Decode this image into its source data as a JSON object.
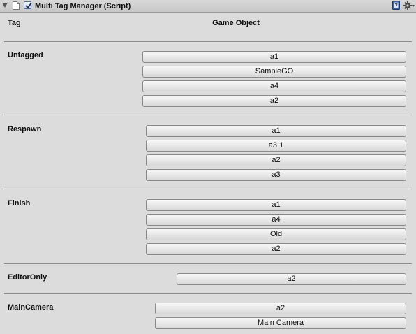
{
  "header": {
    "title": "Multi Tag Manager (Script)",
    "enabled": true,
    "icons": [
      "foldout-arrow-icon",
      "script-icon",
      "help-icon",
      "gear-icon"
    ]
  },
  "columns": {
    "tag": "Tag",
    "game_object": "Game Object"
  },
  "groups": [
    {
      "tag": "Untagged",
      "objects": [
        "a1",
        "SampleGO",
        "a4",
        "a2"
      ]
    },
    {
      "tag": "Respawn",
      "objects": [
        "a1",
        "a3.1",
        "a2",
        "a3"
      ]
    },
    {
      "tag": "Finish",
      "objects": [
        "a1",
        "a4",
        "Old",
        "a2"
      ]
    },
    {
      "tag": "EditorOnly",
      "objects": [
        "a2"
      ]
    },
    {
      "tag": "MainCamera",
      "objects": [
        "a2",
        "Main Camera"
      ]
    }
  ]
}
